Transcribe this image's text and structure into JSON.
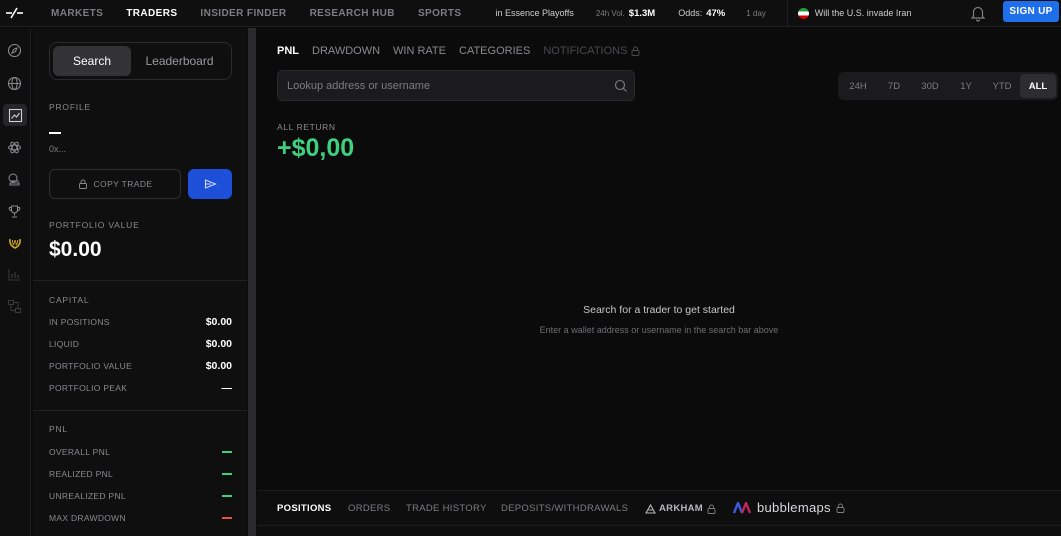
{
  "nav": {
    "items": [
      "MARKETS",
      "TRADERS",
      "INSIDER FINDER",
      "RESEARCH HUB",
      "SPORTS"
    ],
    "active": "TRADERS",
    "ticker": {
      "event": "in Essence Playoffs",
      "vol_label": "24h Vol.",
      "vol_value": "$1.3M",
      "odds_label": "Odds:",
      "odds_value": "47%",
      "period": "1 day",
      "market": "Will the U.S. invade Iran"
    },
    "signup": "SIGN UP"
  },
  "profile": {
    "tabs": [
      "Search",
      "Leaderboard"
    ],
    "profile_label": "PROFILE",
    "address": "0x...",
    "copy_trade": "COPY TRADE",
    "portfolio_value_label": "PORTFOLIO VALUE",
    "portfolio_value": "$0.00",
    "capital_label": "CAPITAL",
    "capital": [
      {
        "label": "IN POSITIONS",
        "value": "$0.00"
      },
      {
        "label": "LIQUID",
        "value": "$0.00"
      },
      {
        "label": "PORTFOLIO VALUE",
        "value": "$0.00"
      },
      {
        "label": "PORTFOLIO PEAK",
        "value": "—"
      }
    ],
    "pnl_label": "PNL",
    "pnl": [
      {
        "label": "OVERALL PNL",
        "color": "#3ecf7f"
      },
      {
        "label": "REALIZED PNL",
        "color": "#3ecf7f"
      },
      {
        "label": "UNREALIZED PNL",
        "color": "#3ecf7f"
      },
      {
        "label": "MAX DRAWDOWN",
        "color": "#e0524a"
      }
    ]
  },
  "main": {
    "tabs": [
      "PNL",
      "DRAWDOWN",
      "WIN RATE",
      "CATEGORIES",
      "NOTIFICATIONS"
    ],
    "search_placeholder": "Lookup address or username",
    "ranges": [
      "24H",
      "7D",
      "30D",
      "1Y",
      "YTD",
      "ALL"
    ],
    "active_range": "ALL",
    "return_label": "ALL RETURN",
    "return_value": "+$0,00",
    "empty_title": "Search for a trader to get started",
    "empty_sub": "Enter a wallet address or username in the search bar above",
    "bottom_tabs": [
      "POSITIONS",
      "ORDERS",
      "TRADE HISTORY",
      "DEPOSITS/WITHDRAWALS",
      "ARKHAM",
      "bubblemaps"
    ]
  },
  "colors": {
    "accent": "#1f6feb",
    "positive": "#3ecf7f",
    "negative": "#e0524a"
  }
}
